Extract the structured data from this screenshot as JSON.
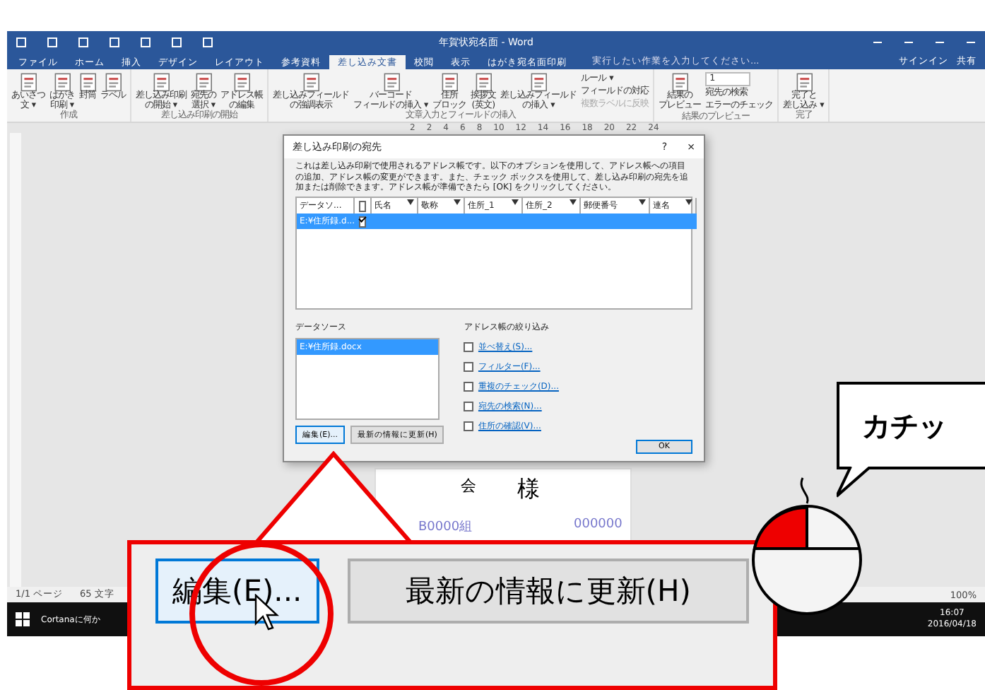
{
  "window": {
    "title": "年賀状宛名面 - Word"
  },
  "tabs": [
    {
      "label": "ファイル",
      "selected": false
    },
    {
      "label": "ホーム",
      "selected": false
    },
    {
      "label": "挿入",
      "selected": false
    },
    {
      "label": "デザイン",
      "selected": false
    },
    {
      "label": "レイアウト",
      "selected": false
    },
    {
      "label": "参考資料",
      "selected": false
    },
    {
      "label": "差し込み文書",
      "selected": true
    },
    {
      "label": "校閲",
      "selected": false
    },
    {
      "label": "表示",
      "selected": false
    },
    {
      "label": "はがき宛名面印刷",
      "selected": false
    }
  ],
  "tell_me": {
    "placeholder": "実行したい作業を入力してください..."
  },
  "account": {
    "sign_in": "サインイン",
    "share": "共有"
  },
  "ribbon_groups": [
    {
      "label": "作成",
      "buttons": [
        {
          "lines": [
            "あいさつ",
            "文 ▾"
          ],
          "disabled": false
        },
        {
          "lines": [
            "はがき",
            "印刷 ▾"
          ],
          "disabled": false
        },
        {
          "lines": [
            "封筒"
          ],
          "disabled": false
        },
        {
          "lines": [
            "ラベル"
          ],
          "disabled": false
        }
      ]
    },
    {
      "label": "差し込み印刷の開始",
      "buttons": [
        {
          "lines": [
            "差し込み印刷",
            "の開始 ▾"
          ],
          "disabled": false
        },
        {
          "lines": [
            "宛先の",
            "選択 ▾"
          ],
          "disabled": false
        },
        {
          "lines": [
            "アドレス帳",
            "の編集"
          ],
          "disabled": false
        }
      ]
    },
    {
      "label": "文章入力とフィールドの挿入",
      "buttons": [
        {
          "lines": [
            "差し込みフィールド",
            "の強調表示"
          ],
          "disabled": false
        },
        {
          "lines": [
            "バーコード",
            "フィールドの挿入 ▾"
          ],
          "disabled": false
        },
        {
          "lines": [
            "住所",
            "ブロック"
          ],
          "disabled": false
        },
        {
          "lines": [
            "挨拶文",
            "(英文)"
          ],
          "disabled": false
        },
        {
          "lines": [
            "差し込みフィールド",
            "の挿入 ▾"
          ],
          "disabled": false
        }
      ],
      "small": [
        {
          "label": "ルール ▾",
          "disabled": false
        },
        {
          "label": "フィールドの対応",
          "disabled": false
        },
        {
          "label": "複数ラベルに反映",
          "disabled": true
        }
      ]
    },
    {
      "label": "結果のプレビュー",
      "buttons": [
        {
          "lines": [
            "結果の",
            "プレビュー"
          ],
          "disabled": false
        }
      ],
      "record": "1",
      "small": [
        {
          "label": "宛先の検索",
          "disabled": false
        },
        {
          "label": "エラーのチェック",
          "disabled": false
        }
      ]
    },
    {
      "label": "完了",
      "buttons": [
        {
          "lines": [
            "完了と",
            "差し込み ▾"
          ],
          "disabled": false
        }
      ]
    }
  ],
  "ruler": [
    "2",
    "2",
    "4",
    "6",
    "8",
    "10",
    "12",
    "14",
    "16",
    "18",
    "20",
    "22",
    "24"
  ],
  "document": {
    "postcard_texts": [
      "会",
      "様",
      "B0000組",
      "000000"
    ]
  },
  "dialog": {
    "title": "差し込み印刷の宛先",
    "help": "?",
    "close": "×",
    "description": "これは差し込み印刷で使用されるアドレス帳です。以下のオプションを使用して、アドレス帳への項目の追加、アドレス帳の変更ができます。また、チェック ボックスを使用して、差し込み印刷の宛先を追加または削除できます。アドレス帳が準備できたら [OK] をクリックしてください。",
    "columns": [
      "データソ...",
      "",
      "氏名",
      "敬称",
      "住所_1",
      "住所_2",
      "郵便番号",
      "連名"
    ],
    "header_checked": false,
    "rows": [
      {
        "source": "E:¥住所録.d...",
        "checked": true,
        "selected": true
      }
    ],
    "data_source": {
      "label": "データソース",
      "items": [
        {
          "label": "E:¥住所録.docx",
          "selected": true
        }
      ]
    },
    "buttons": [
      "編集(E)...",
      "最新の情報に更新(H)"
    ],
    "refine": {
      "label": "アドレス帳の絞り込み",
      "links": [
        "並べ替え(S)...",
        "フィルター(F)...",
        "重複のチェック(D)...",
        "宛先の検索(N)...",
        "住所の確認(V)..."
      ]
    },
    "ok": "OK"
  },
  "status_bar": {
    "page": "1/1 ページ",
    "words": "65 文字",
    "zoom": "100%"
  },
  "taskbar": {
    "search": "Cortanaに何か",
    "time": "16:07",
    "date": "2016/04/18"
  },
  "callout": {
    "buttons": [
      {
        "label": "編集(E)...",
        "selected": true
      },
      {
        "label": "最新の情報に更新(H)",
        "selected": false
      }
    ]
  },
  "speech_bubble": {
    "text": "カチッ"
  },
  "mouse": {
    "left_pressed": true
  }
}
